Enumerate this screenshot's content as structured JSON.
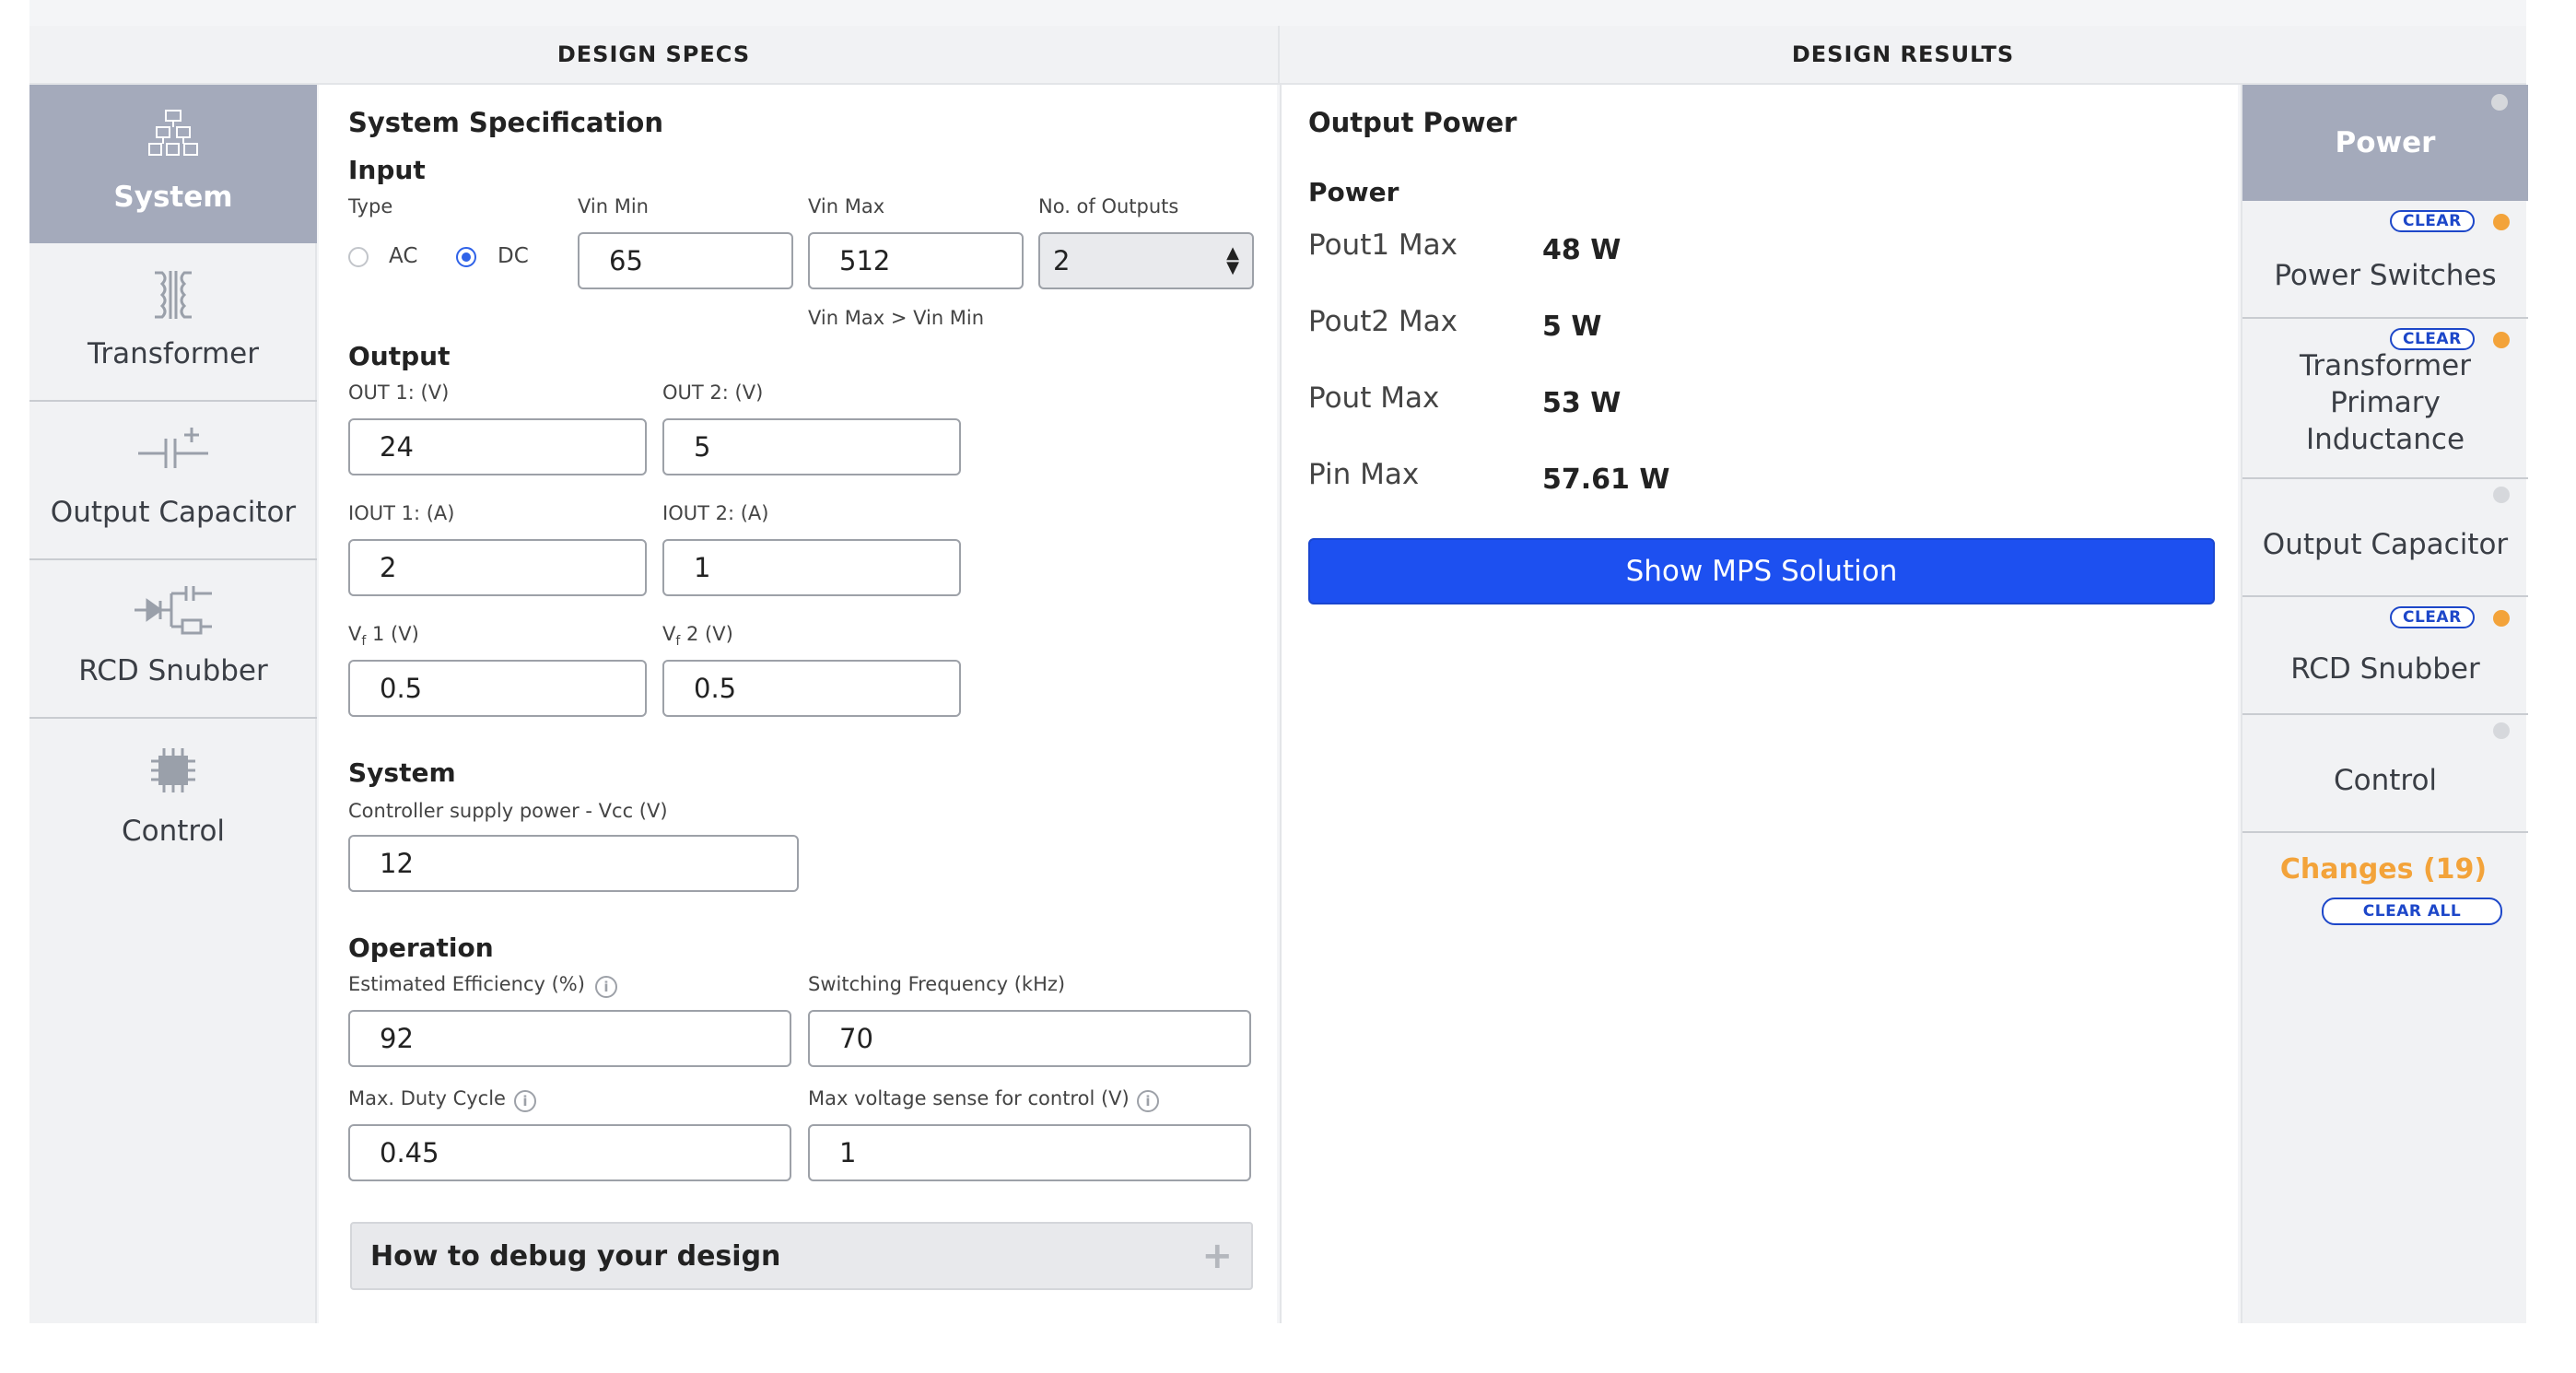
{
  "headers": {
    "specs": "DESIGN SPECS",
    "results": "DESIGN RESULTS"
  },
  "left_nav": {
    "items": [
      {
        "label": "System",
        "icon": "hierarchy-icon",
        "active": true
      },
      {
        "label": "Transformer",
        "icon": "transformer-icon",
        "active": false
      },
      {
        "label": "Output Capacitor",
        "icon": "capacitor-icon",
        "active": false
      },
      {
        "label": "RCD Snubber",
        "icon": "snubber-icon",
        "active": false
      },
      {
        "label": "Control",
        "icon": "chip-icon",
        "active": false
      }
    ]
  },
  "spec": {
    "title": "System Specification",
    "input": {
      "title": "Input",
      "type_label": "Type",
      "ac_label": "AC",
      "dc_label": "DC",
      "selected_type": "DC",
      "vin_min_label": "Vin Min",
      "vin_min_value": "65",
      "vin_max_label": "Vin Max",
      "vin_max_value": "512",
      "vin_hint": "Vin Max > Vin Min",
      "outputs_label": "No. of Outputs",
      "outputs_value": "2"
    },
    "output": {
      "title": "Output",
      "out1_label": "OUT 1: (V)",
      "out1_value": "24",
      "out2_label": "OUT 2: (V)",
      "out2_value": "5",
      "iout1_label": "IOUT 1: (A)",
      "iout1_value": "2",
      "iout2_label": "IOUT 2: (A)",
      "iout2_value": "1",
      "vf1_prefix": "V",
      "vf1_sub": "f",
      "vf1_suffix": " 1 (V)",
      "vf1_value": "0.5",
      "vf2_prefix": "V",
      "vf2_sub": "f",
      "vf2_suffix": " 2 (V)",
      "vf2_value": "0.5"
    },
    "system": {
      "title": "System",
      "vcc_label": "Controller supply power - Vcc (V)",
      "vcc_value": "12"
    },
    "operation": {
      "title": "Operation",
      "eff_label": "Estimated Efficiency (%)",
      "eff_value": "92",
      "fsw_label": "Switching Frequency (kHz)",
      "fsw_value": "70",
      "duty_label": "Max. Duty Cycle",
      "duty_value": "0.45",
      "vsense_label": "Max voltage sense for control (V)",
      "vsense_value": "1"
    },
    "info_glyph": "i",
    "debug_label": "How to debug your design",
    "debug_icon": "plus-icon"
  },
  "results": {
    "title": "Output Power",
    "subtitle": "Power",
    "rows": [
      {
        "label": "Pout1 Max",
        "value": "48 W"
      },
      {
        "label": "Pout2 Max",
        "value": "5 W"
      },
      {
        "label": "Pout Max",
        "value": "53 W"
      },
      {
        "label": "Pin Max",
        "value": "57.61 W"
      }
    ],
    "button_label": "Show MPS Solution"
  },
  "right_nav": {
    "items": [
      {
        "label": "Power",
        "active": true,
        "status": "grey",
        "clear": false
      },
      {
        "label": "Power Switches",
        "active": false,
        "status": "orange",
        "clear": true
      },
      {
        "label": "Transformer Primary Inductance",
        "active": false,
        "status": "orange",
        "clear": true
      },
      {
        "label": "Output Capacitor",
        "active": false,
        "status": "grey",
        "clear": false
      },
      {
        "label": "RCD Snubber",
        "active": false,
        "status": "orange",
        "clear": true
      },
      {
        "label": "Control",
        "active": false,
        "status": "grey",
        "clear": false
      }
    ],
    "clear_label": "CLEAR",
    "changes_label": "Changes (19)",
    "clear_all_label": "CLEAR ALL"
  },
  "colors": {
    "accent_blue": "#1d50f0",
    "nav_active": "#a4aabb",
    "status_orange": "#f3a33a",
    "status_grey": "#d6d8dc"
  }
}
